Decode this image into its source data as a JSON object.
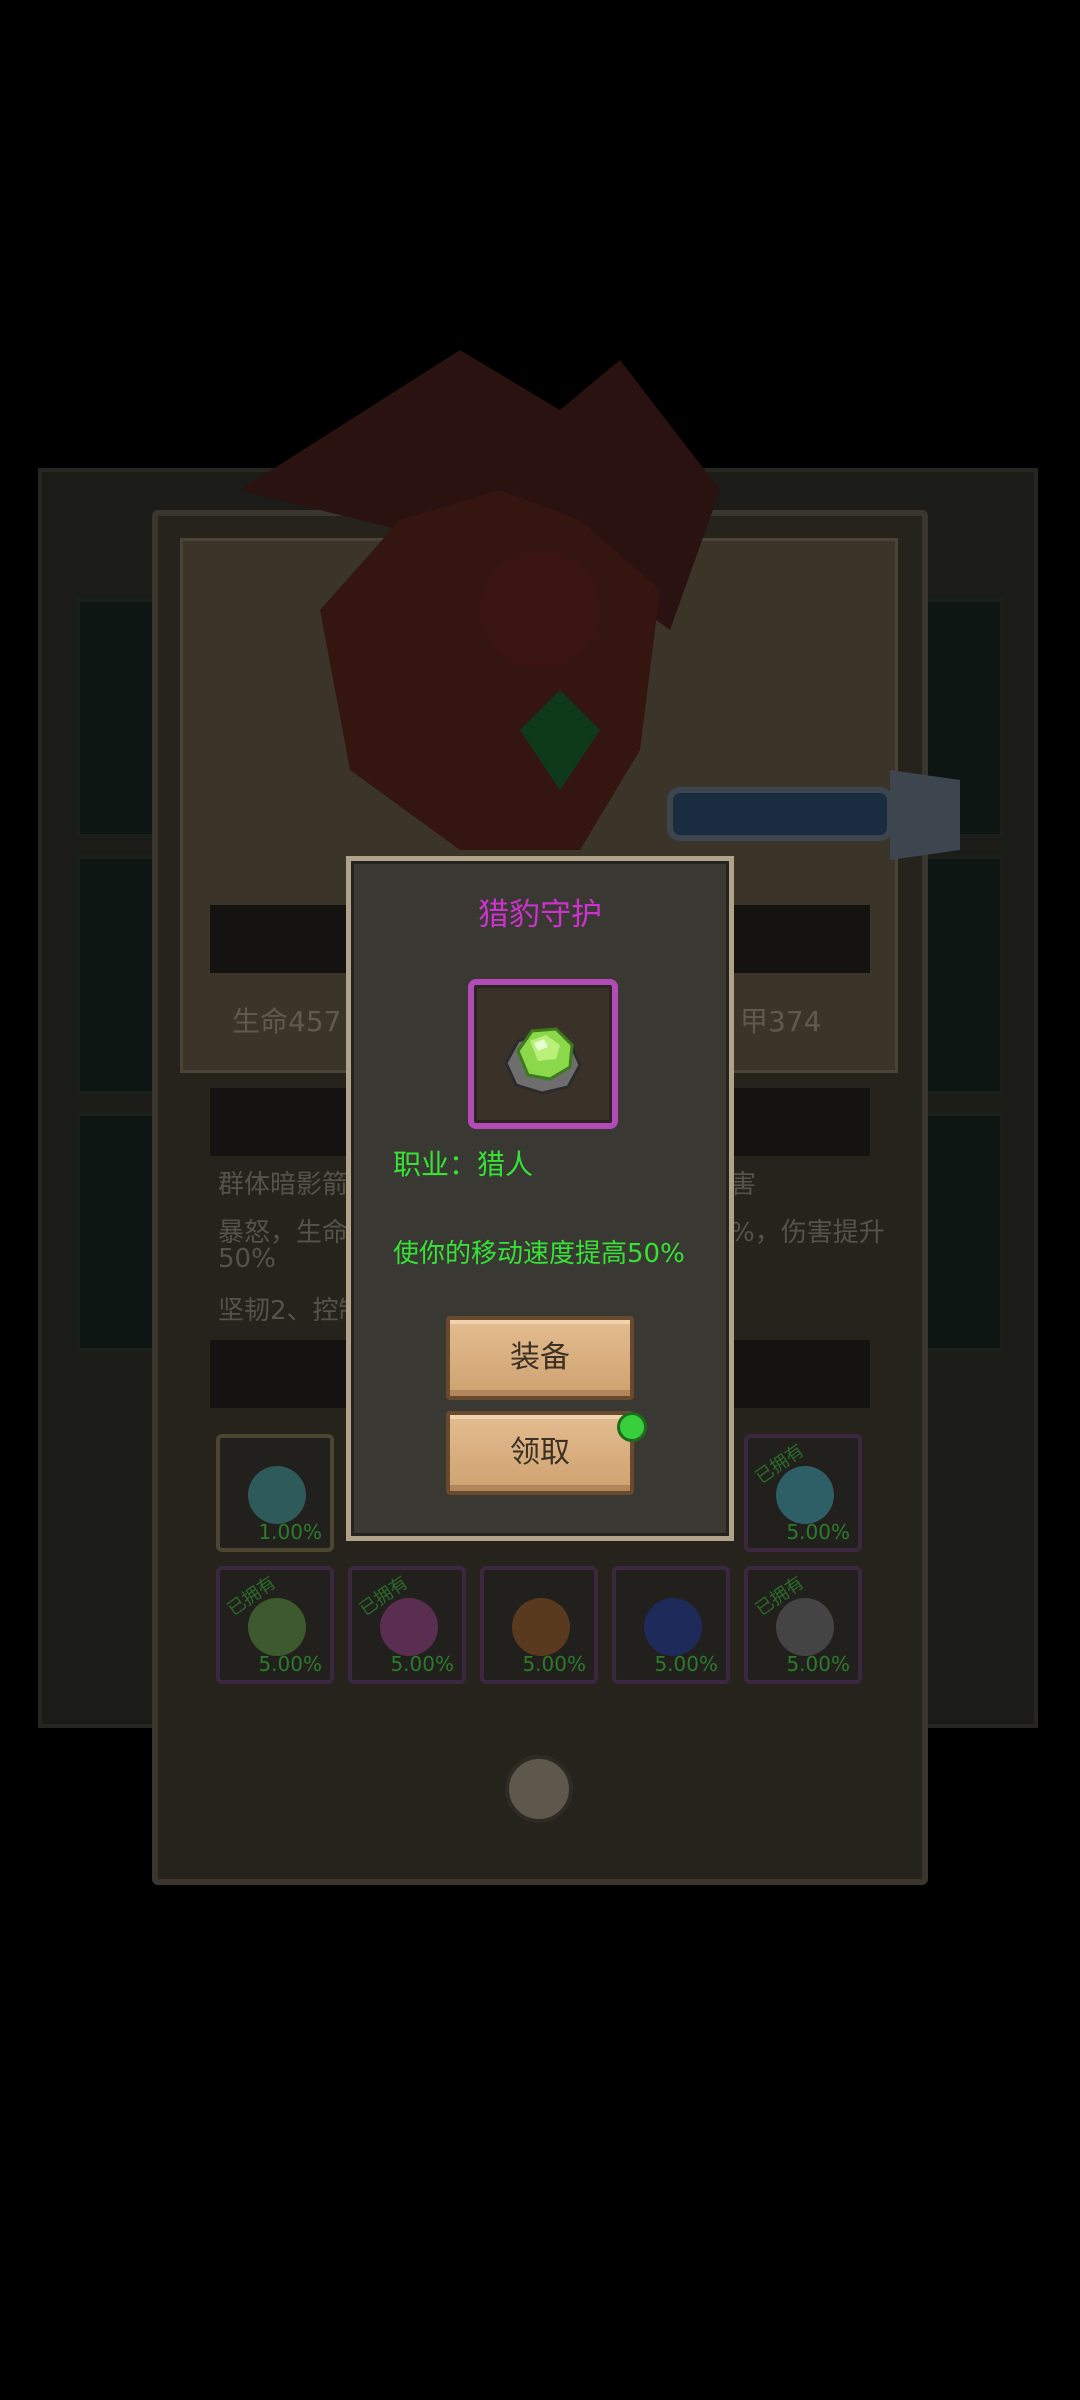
{
  "background": {
    "stats": {
      "hp_label": "生命457",
      "armor_label": "甲374"
    },
    "skills": {
      "line1": "群体暗影箭",
      "line1_tail": "害",
      "line2": "暴怒，生命",
      "line2_tail": "%，伤害提升",
      "line2_wrap": "50%",
      "line3": "坚韧2、控制"
    },
    "gem_slots_row1": [
      {
        "percent": "1.00%",
        "owned": false,
        "color": "#2e5a5a"
      },
      {
        "percent": "5.00%",
        "owned": true,
        "owned_label": "已拥有",
        "color": "#2e5e66"
      }
    ],
    "gem_slots_row2": [
      {
        "percent": "5.00%",
        "owned": true,
        "owned_label": "已拥有",
        "color": "#3c5a2e"
      },
      {
        "percent": "5.00%",
        "owned": true,
        "owned_label": "已拥有",
        "color": "#5a2e50"
      },
      {
        "percent": "5.00%",
        "owned": false,
        "color": "#5a3a1e"
      },
      {
        "percent": "5.00%",
        "owned": false,
        "color": "#1e2a5a"
      },
      {
        "percent": "5.00%",
        "owned": true,
        "owned_label": "已拥有",
        "color": "#444"
      }
    ]
  },
  "modal": {
    "title": "猎豹守护",
    "item_icon": "green-gem-icon",
    "class_line": "职业：猎人",
    "effect_line": "使你的移动速度提高50%",
    "equip_label": "装备",
    "claim_label": "领取"
  },
  "colors": {
    "title": "#cc33cc",
    "effect_text": "#36e236",
    "item_border": "#b24ab8"
  }
}
